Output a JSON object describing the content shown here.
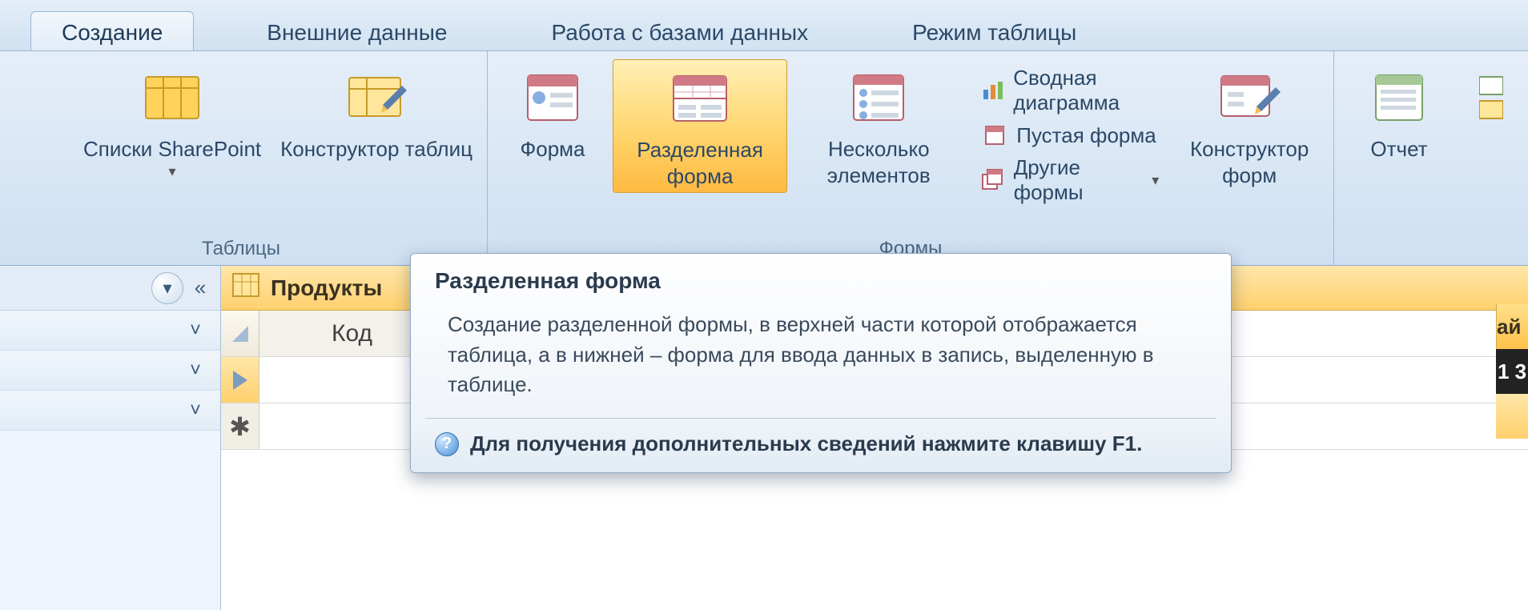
{
  "tabs": {
    "active": "Создание",
    "others": [
      "Внешние данные",
      "Работа с базами данных",
      "Режим таблицы"
    ]
  },
  "ribbon": {
    "group_tables": {
      "label": "Таблицы",
      "sharepoint": "Списки SharePoint",
      "table_design": "Конструктор таблиц"
    },
    "group_forms": {
      "label": "Формы",
      "form": "Форма",
      "split_form": "Разделенная форма",
      "multiple_items": "Несколько элементов",
      "pivot_chart": "Сводная диаграмма",
      "blank_form": "Пустая форма",
      "more_forms": "Другие формы",
      "form_design": "Конструктор форм"
    },
    "group_reports": {
      "report": "Отчет"
    }
  },
  "nav": {
    "dropdown_glyph": "▾",
    "collapse_glyph": "«",
    "item_glyph": "˅"
  },
  "sheet": {
    "tab_title": "Продукты",
    "col1_header": "Код",
    "new_row_paren": "("
  },
  "tooltip": {
    "title": "Разделенная форма",
    "body": "Создание разделенной формы, в верхней части которой отображается таблица, а в нижней – форма для ввода данных в запись, выделенную в таблице.",
    "help": "Для получения дополнительных сведений нажмите клавишу F1."
  },
  "far_right": {
    "yellow_text": "ай",
    "dark_text": "1 3"
  }
}
